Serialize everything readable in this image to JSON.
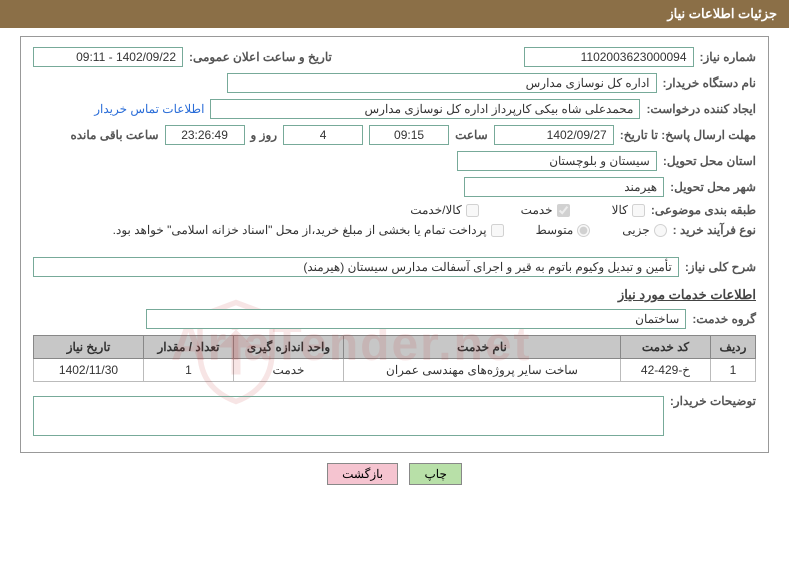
{
  "header": {
    "title": "جزئیات اطلاعات نیاز"
  },
  "fields": {
    "need_number_label": "شماره نیاز:",
    "need_number": "1102003623000094",
    "announce_date_label": "تاریخ و ساعت اعلان عمومی:",
    "announce_date": "1402/09/22 - 09:11",
    "buyer_org_label": "نام دستگاه خریدار:",
    "buyer_org": "اداره کل نوسازی مدارس",
    "requester_label": "ایجاد کننده درخواست:",
    "requester": "محمدعلی شاه بیکی کارپرداز اداره کل نوسازی مدارس",
    "contact_link": "اطلاعات تماس خریدار",
    "deadline_label": "مهلت ارسال پاسخ: تا تاریخ:",
    "deadline_date": "1402/09/27",
    "time_label": "ساعت",
    "deadline_time": "09:15",
    "days_value": "4",
    "days_and": "روز و",
    "countdown": "23:26:49",
    "remaining_label": "ساعت باقی مانده",
    "province_label": "استان محل تحویل:",
    "province": "سیستان و بلوچستان",
    "city_label": "شهر محل تحویل:",
    "city": "هیرمند",
    "category_label": "طبقه بندی موضوعی:",
    "cat_goods": "کالا",
    "cat_service": "خدمت",
    "cat_both": "کالا/خدمت",
    "process_label": "نوع فرآیند خرید :",
    "proc_minor": "جزیی",
    "proc_medium": "متوسط",
    "payment_note": "پرداخت تمام یا بخشی از مبلغ خرید،از محل \"اسناد خزانه اسلامی\" خواهد بود.",
    "need_desc_label": "شرح کلی نیاز:",
    "need_desc": "تأمین و تبدیل وکیوم باتوم به قیر و اجرای آسفالت مدارس سیستان (هیرمند)",
    "service_info_title": "اطلاعات خدمات مورد نیاز",
    "service_group_label": "گروه خدمت:",
    "service_group": "ساختمان",
    "buyer_notes_label": "توضیحات خریدار:"
  },
  "table": {
    "headers": {
      "row": "ردیف",
      "code": "کد خدمت",
      "name": "نام خدمت",
      "unit": "واحد اندازه گیری",
      "qty": "تعداد / مقدار",
      "date": "تاریخ نیاز"
    },
    "rows": [
      {
        "row": "1",
        "code": "خ-429-42",
        "name": "ساخت سایر پروژه‌های مهندسی عمران",
        "unit": "خدمت",
        "qty": "1",
        "date": "1402/11/30"
      }
    ]
  },
  "buttons": {
    "print": "چاپ",
    "back": "بازگشت"
  }
}
